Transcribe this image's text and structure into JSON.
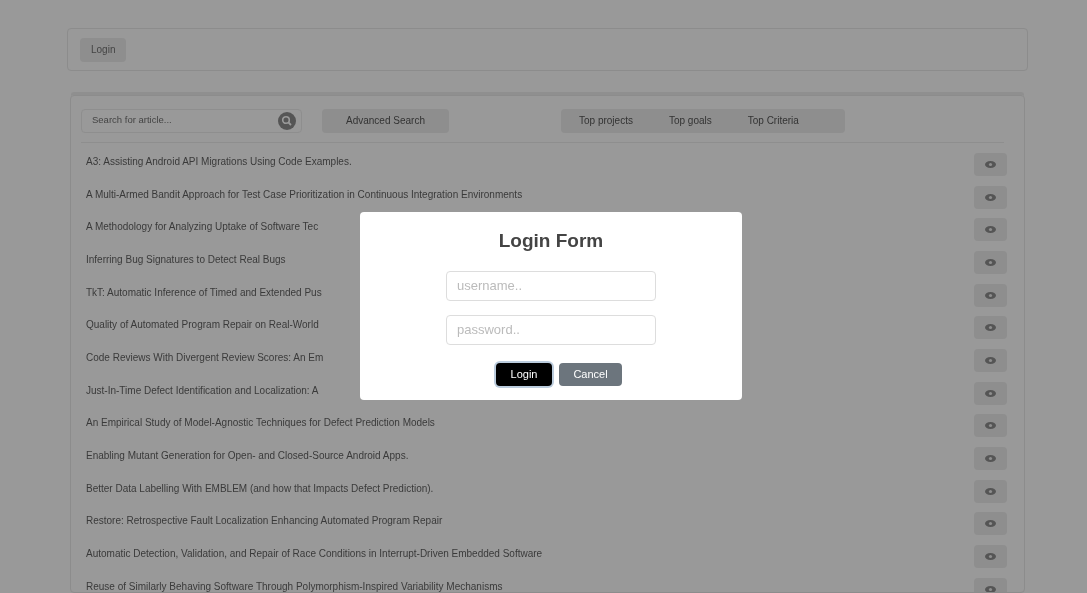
{
  "top_bar": {
    "login_button": "Login"
  },
  "toolbar": {
    "search": {
      "placeholder": "Search for article..."
    },
    "advanced_search": "Advanced Search",
    "top_links": [
      "Top projects",
      "Top goals",
      "Top Criteria"
    ]
  },
  "articles": [
    "A3: Assisting Android API Migrations Using Code Examples.",
    "A Multi-Armed Bandit Approach for Test Case Prioritization in Continuous Integration Environments",
    "A Methodology for Analyzing Uptake of Software Tec",
    "Inferring Bug Signatures to Detect Real Bugs",
    "TkT: Automatic Inference of Timed and Extended Pus",
    "Quality of Automated Program Repair on Real-World",
    "Code Reviews With Divergent Review Scores: An Em",
    "Just-In-Time Defect Identification and Localization: A",
    "An Empirical Study of Model-Agnostic Techniques for Defect Prediction Models",
    "Enabling Mutant Generation for Open- and Closed-Source Android Apps.",
    "Better Data Labelling With EMBLEM (and how that Impacts Defect Prediction).",
    "Restore: Retrospective Fault Localization Enhancing Automated Program Repair",
    "Automatic Detection, Validation, and Repair of Race Conditions in Interrupt-Driven Embedded Software",
    "Reuse of Similarly Behaving Software Through Polymorphism-Inspired Variability Mechanisms"
  ],
  "modal": {
    "title": "Login Form",
    "username": {
      "placeholder": "username.."
    },
    "password": {
      "placeholder": "password.."
    },
    "buttons": [
      {
        "label": "Login",
        "kind": "primary"
      },
      {
        "label": "Cancel",
        "kind": "secondary"
      }
    ]
  }
}
